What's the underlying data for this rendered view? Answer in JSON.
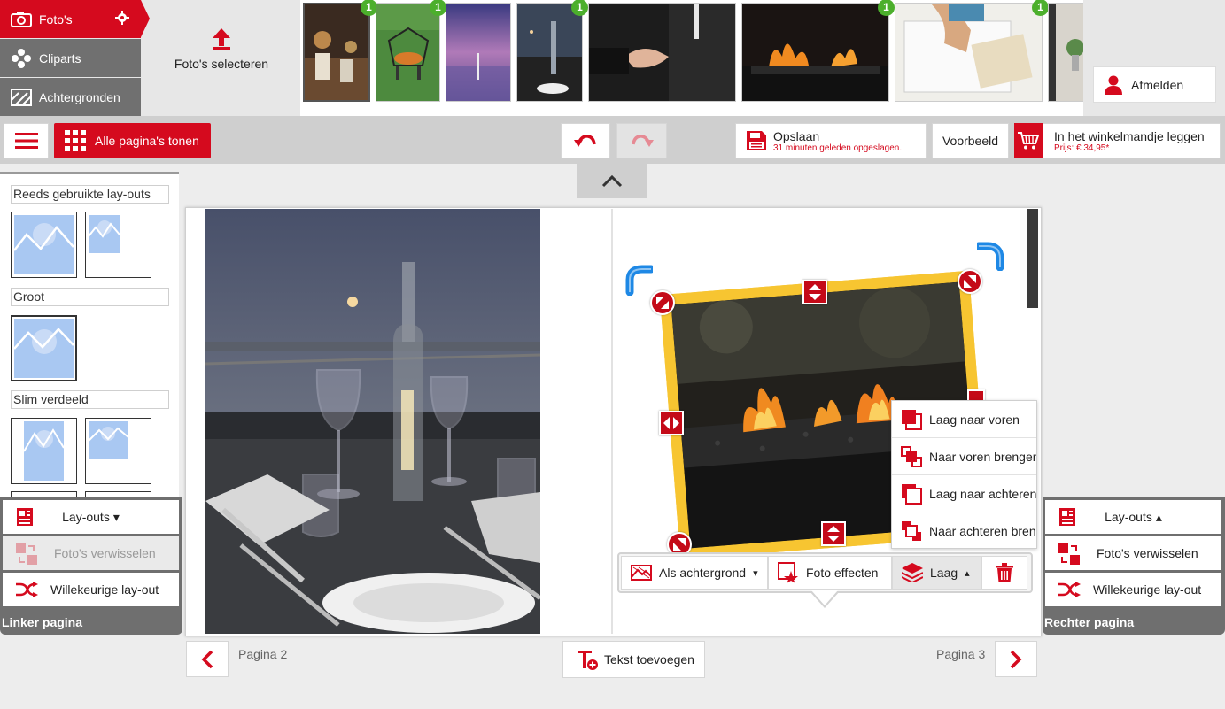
{
  "categories": {
    "photos": "Foto's",
    "cliparts": "Cliparts",
    "backgrounds": "Achtergronden"
  },
  "upload": {
    "label": "Foto's selecteren"
  },
  "thumbnails": [
    {
      "name": "restaurant-table-candle",
      "badge": "1"
    },
    {
      "name": "fire-pit-lawn",
      "badge": "1"
    },
    {
      "name": "purple-sunset-lake",
      "badge": ""
    },
    {
      "name": "dusk-table-bottle",
      "badge": "1"
    },
    {
      "name": "handshake-suit",
      "badge": ""
    },
    {
      "name": "fire-pit-flames",
      "badge": "1"
    },
    {
      "name": "writing-on-paper",
      "badge": "1"
    },
    {
      "name": "plant-interior",
      "badge": ""
    }
  ],
  "account": {
    "logout_label": "Afmelden"
  },
  "toolbar": {
    "all_pages_label": "Alle pagina's tonen",
    "save_label": "Opslaan",
    "save_status": "31 minuten geleden opgeslagen.",
    "preview_label": "Voorbeeld",
    "cart_label": "In het winkelmandje leggen",
    "cart_price": "Prijs: € 34,95*"
  },
  "layout_panel": {
    "section_used": "Reeds gebruikte lay-outs",
    "section_large": "Groot",
    "section_smart": "Slim verdeeld"
  },
  "left_tools": {
    "layouts_label": "Lay-outs",
    "swap_label": "Foto's verwisselen",
    "random_label": "Willekeurige lay-out",
    "caption": "Linker pagina"
  },
  "right_tools": {
    "layouts_label": "Lay-outs",
    "swap_label": "Foto's verwisselen",
    "random_label": "Willekeurige lay-out",
    "caption": "Rechter pagina"
  },
  "layer_menu": [
    {
      "label": "Laag naar voren",
      "icon": "layer-forward-icon"
    },
    {
      "label": "Naar voren brengen",
      "icon": "bring-to-front-icon"
    },
    {
      "label": "Laag naar achteren",
      "icon": "layer-backward-icon"
    },
    {
      "label": "Naar achteren brengen",
      "icon": "send-to-back-icon"
    }
  ],
  "photo_toolbar": {
    "background_label": "Als achtergrond",
    "effects_label": "Foto effecten",
    "layer_label": "Laag"
  },
  "pages": {
    "left_label": "Pagina 2",
    "right_label": "Pagina 3"
  },
  "add_text_label": "Tekst toevoegen",
  "colors": {
    "accent": "#d50a1e",
    "panel_gray": "#707070",
    "frame_yellow": "#f7c531",
    "badge_green": "#4caf2c",
    "rotate_blue": "#1e88e5"
  }
}
